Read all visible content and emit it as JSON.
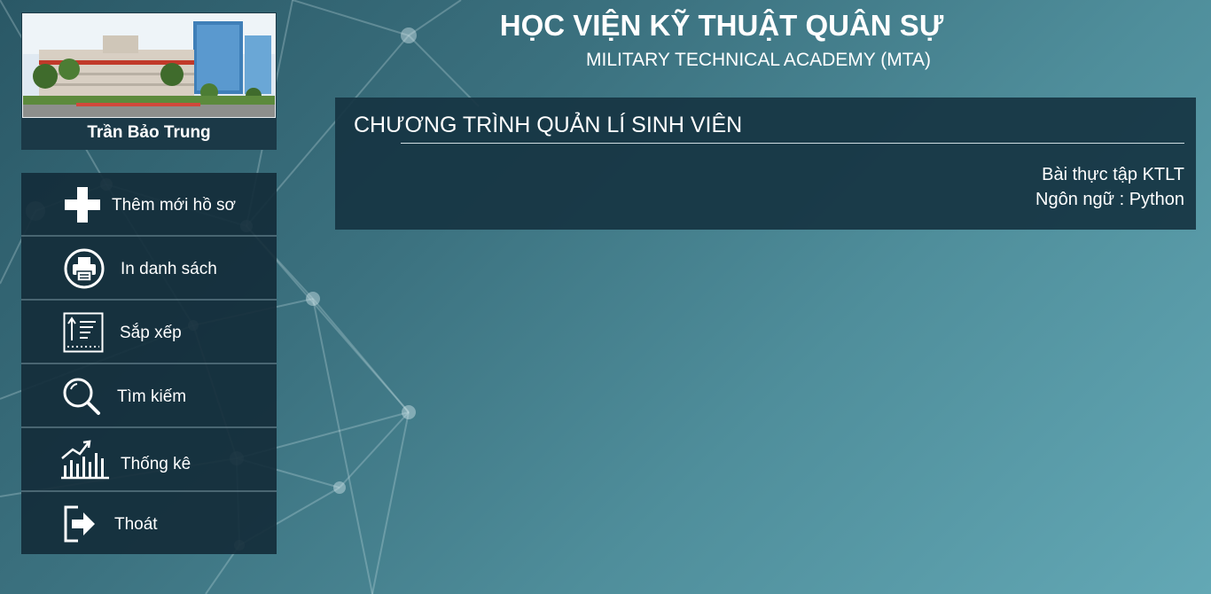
{
  "header": {
    "title": "HỌC VIỆN KỸ THUẬT QUÂN SỰ",
    "subtitle": "MILITARY TECHNICAL ACADEMY (MTA)"
  },
  "profile": {
    "name": "Trần Bảo Trung"
  },
  "menu": {
    "items": [
      {
        "label": "Thêm mới hồ sơ",
        "icon": "plus-icon"
      },
      {
        "label": "In danh sách",
        "icon": "printer-icon"
      },
      {
        "label": "Sắp xếp",
        "icon": "sort-icon"
      },
      {
        "label": "Tìm kiếm",
        "icon": "search-icon"
      },
      {
        "label": "Thống kê",
        "icon": "statistics-icon"
      },
      {
        "label": "Thoát",
        "icon": "exit-icon"
      }
    ]
  },
  "panel": {
    "title": "CHƯƠNG TRÌNH QUẢN LÍ SINH VIÊN",
    "line1": "Bài thực tập KTLT",
    "line2": "Ngôn ngữ : Python"
  },
  "colors": {
    "background_start": "#2a5866",
    "background_end": "#63a8b5",
    "panel": "#163442",
    "menu": "#142d3a"
  }
}
